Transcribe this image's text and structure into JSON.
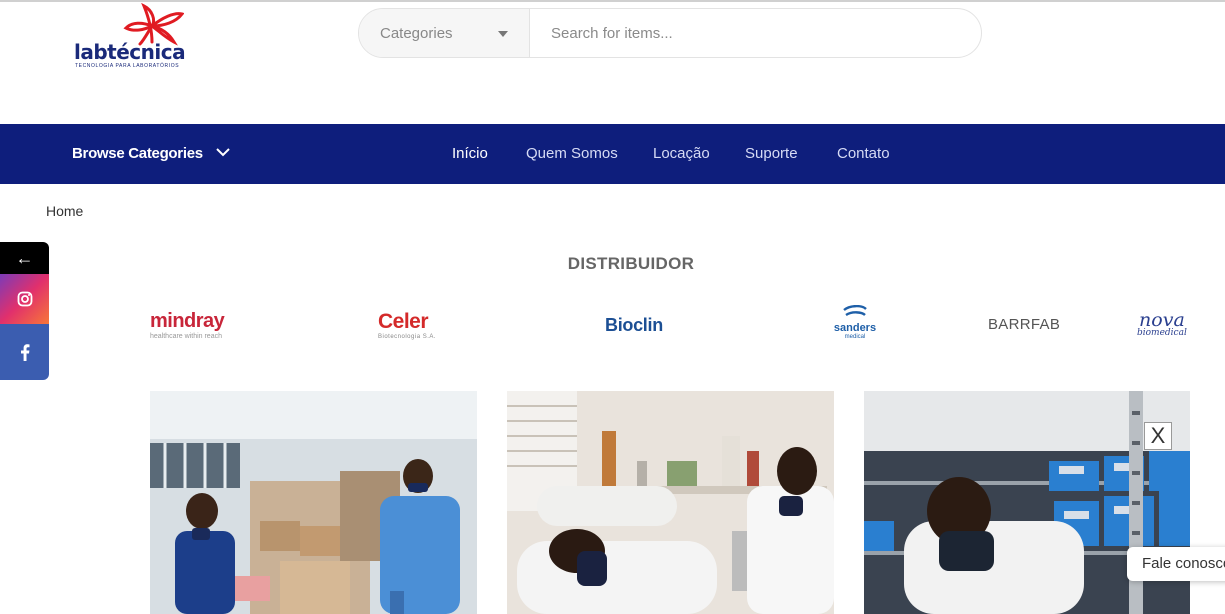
{
  "logo": {
    "text": "labtécnica",
    "tagline": "TECNOLOGIA PARA LABORATÓRIOS"
  },
  "search": {
    "category_label": "Categories",
    "placeholder": "Search for items..."
  },
  "nav": {
    "browse_label": "Browse Categories",
    "items": [
      {
        "label": "Início"
      },
      {
        "label": "Quem Somos"
      },
      {
        "label": "Locação"
      },
      {
        "label": "Suporte"
      },
      {
        "label": "Contato"
      }
    ]
  },
  "breadcrumb": {
    "home": "Home"
  },
  "social": {
    "back_icon": "arrow-left-icon",
    "instagram_icon": "instagram-icon",
    "facebook_icon": "facebook-icon"
  },
  "distributor": {
    "title": "DISTRIBUIDOR",
    "brands": {
      "mindray": {
        "name": "mindray",
        "sub": "healthcare within reach"
      },
      "celer": {
        "name": "Celer",
        "sub": "Biotecnologia S.A."
      },
      "bioclin": {
        "name": "Bioclin"
      },
      "sanders": {
        "name": "sanders",
        "sub": "medical"
      },
      "barrfab": {
        "name": "BARRFAB"
      },
      "nova": {
        "name": "nova",
        "sub": "biomedical"
      }
    }
  },
  "close_button": "X",
  "chat": {
    "label": "Fale conosco"
  },
  "colors": {
    "navbar": "#0e1e7c",
    "brand_red": "#e01b22",
    "brand_blue": "#1a2a7a"
  }
}
